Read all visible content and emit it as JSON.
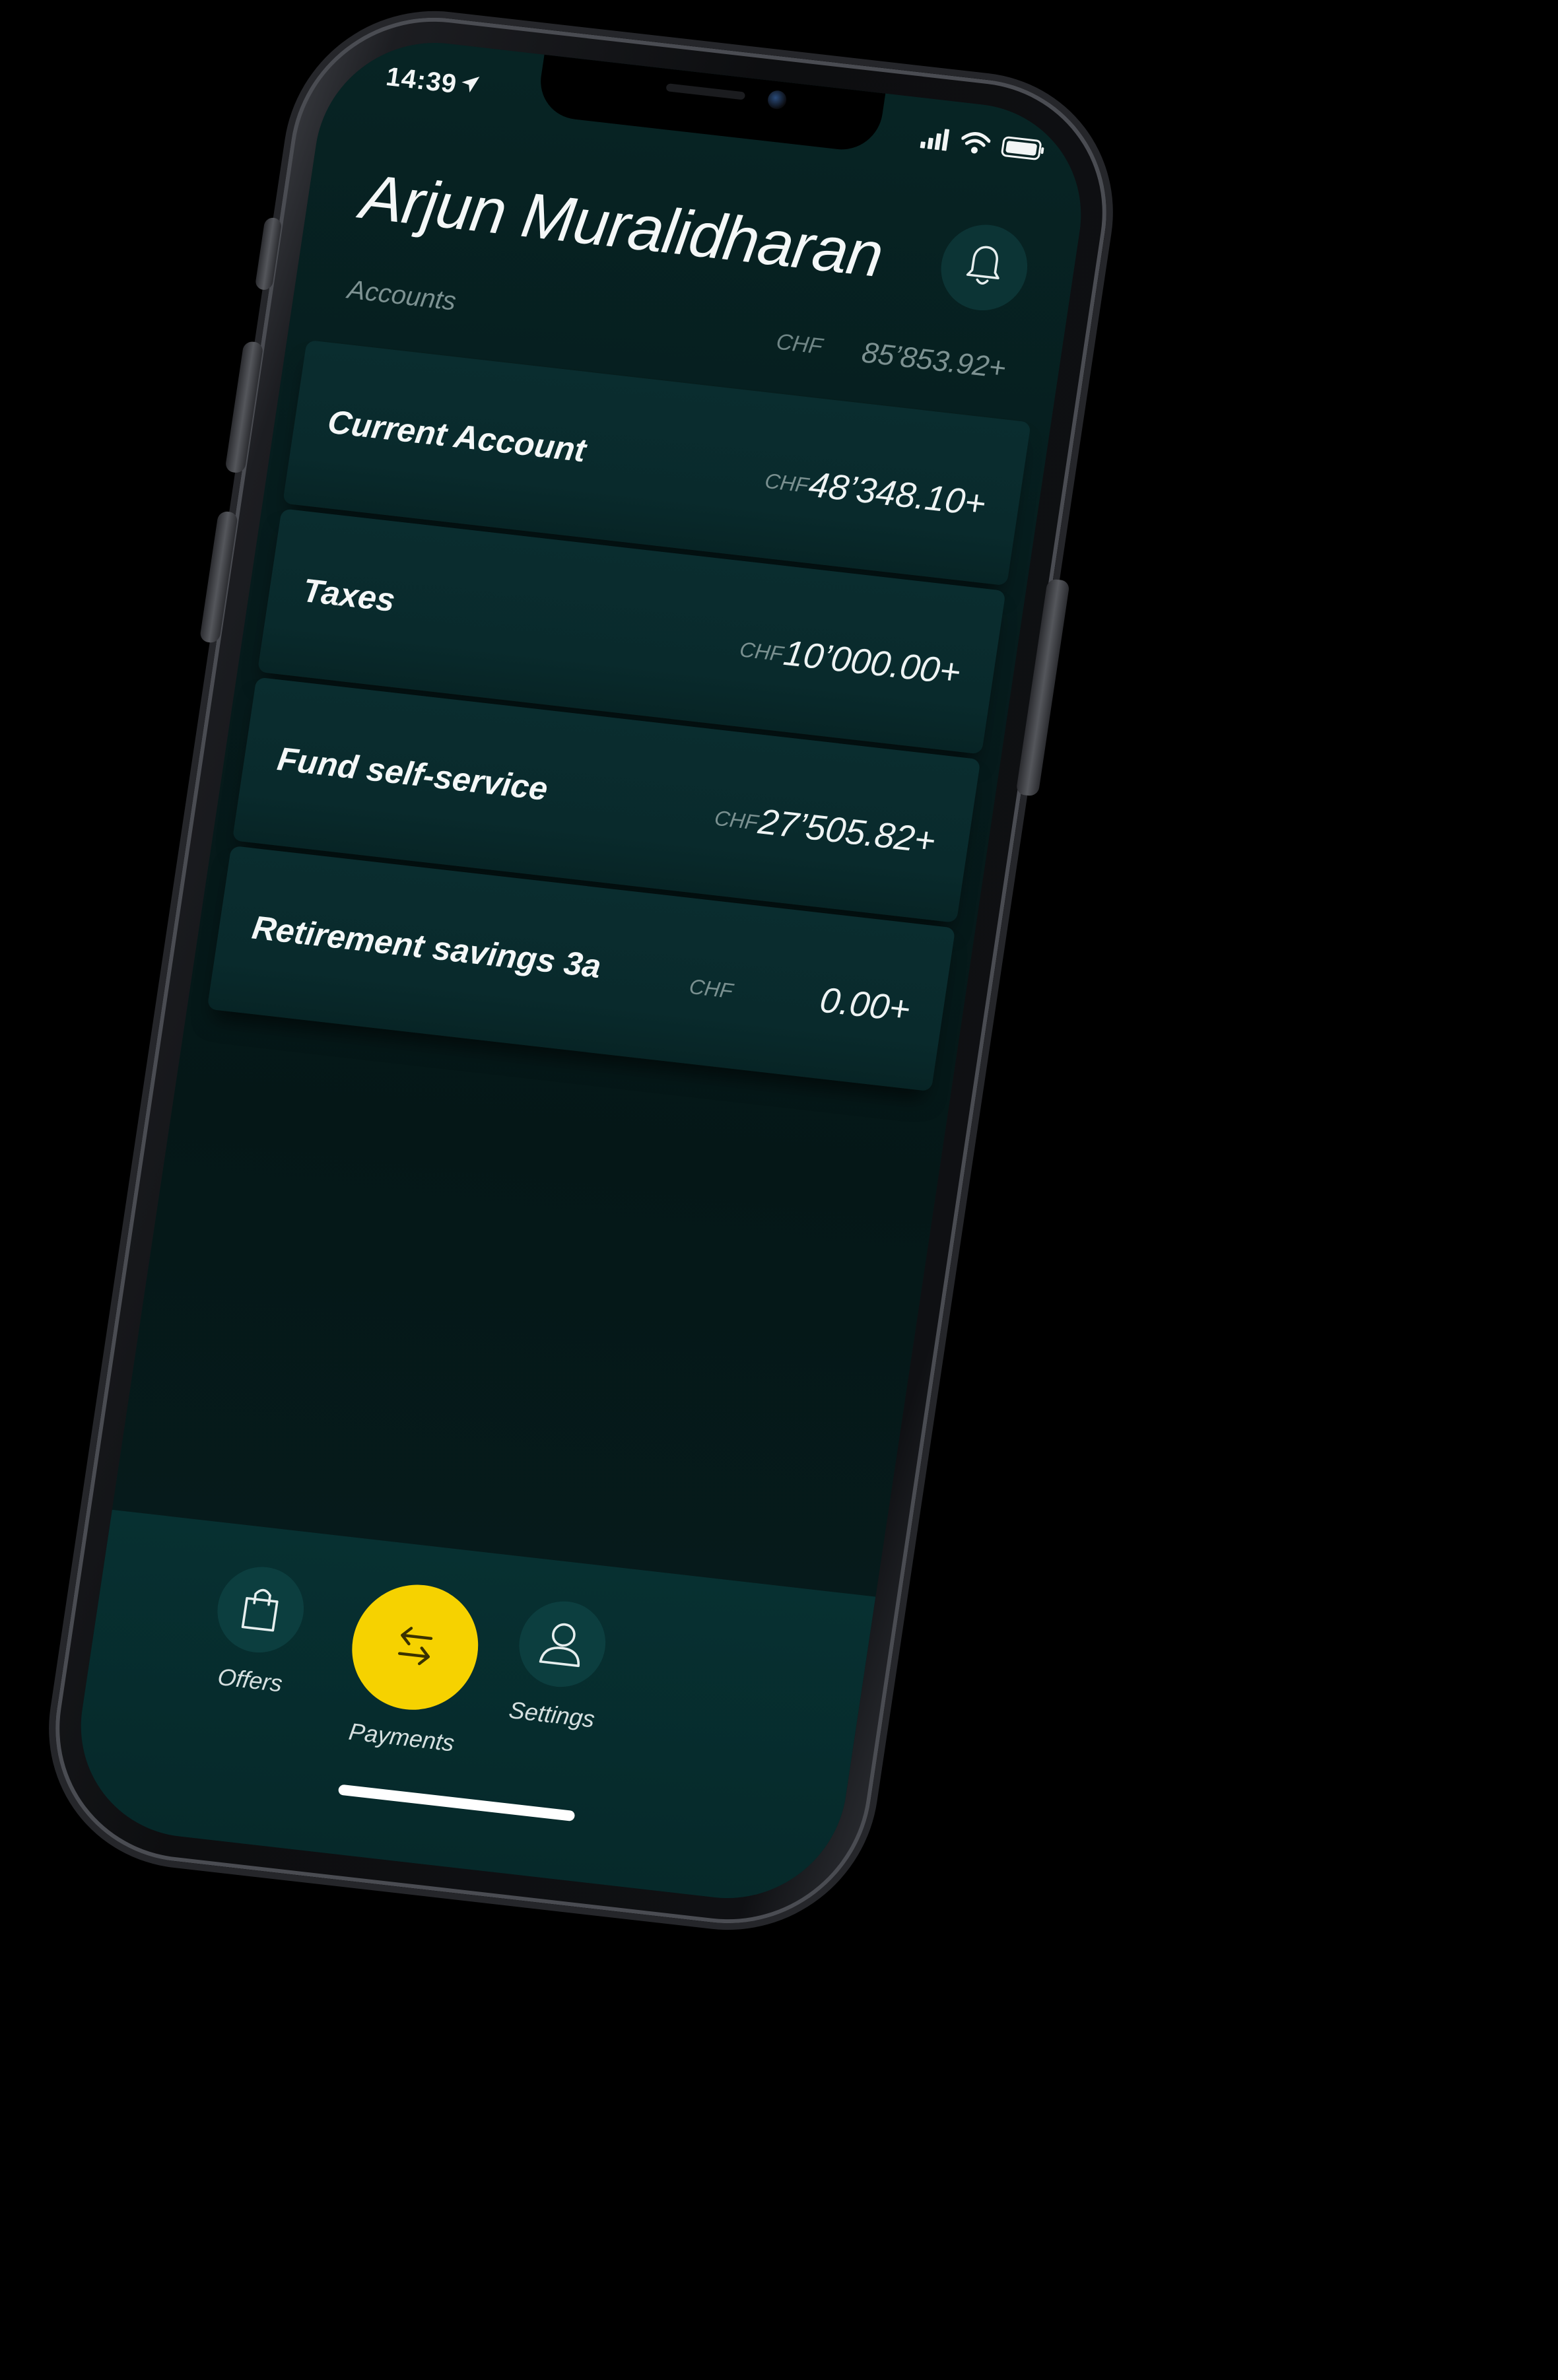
{
  "status_bar": {
    "time": "14:39",
    "icons": [
      "location-arrow-icon",
      "cellular-signal-icon",
      "wifi-icon",
      "battery-icon"
    ]
  },
  "header": {
    "user_name": "Arjun Muralidharan",
    "bell_icon": "bell-icon"
  },
  "accounts_summary": {
    "label": "Accounts",
    "currency": "CHF",
    "total": "85’853.92+"
  },
  "accounts": [
    {
      "name": "Current Account",
      "currency": "CHF",
      "amount": "48’348.10+"
    },
    {
      "name": "Taxes",
      "currency": "CHF",
      "amount": "10’000.00+"
    },
    {
      "name": "Fund self-service",
      "currency": "CHF",
      "amount": "27’505.82+"
    },
    {
      "name": "Retirement savings 3a",
      "currency": "CHF",
      "amount": "0.00+"
    }
  ],
  "tab_bar": {
    "tabs": [
      {
        "label": "Offers",
        "icon": "shopping-bag-icon"
      },
      {
        "label": "Payments",
        "icon": "transfer-arrows-icon"
      },
      {
        "label": "Settings",
        "icon": "user-icon"
      }
    ]
  },
  "colors": {
    "screen_background": "#061b1c",
    "card_background": "#0a2d2f",
    "accent_yellow": "#f6d200",
    "text_primary": "#f4f7f7",
    "text_muted": "#7d9292"
  }
}
